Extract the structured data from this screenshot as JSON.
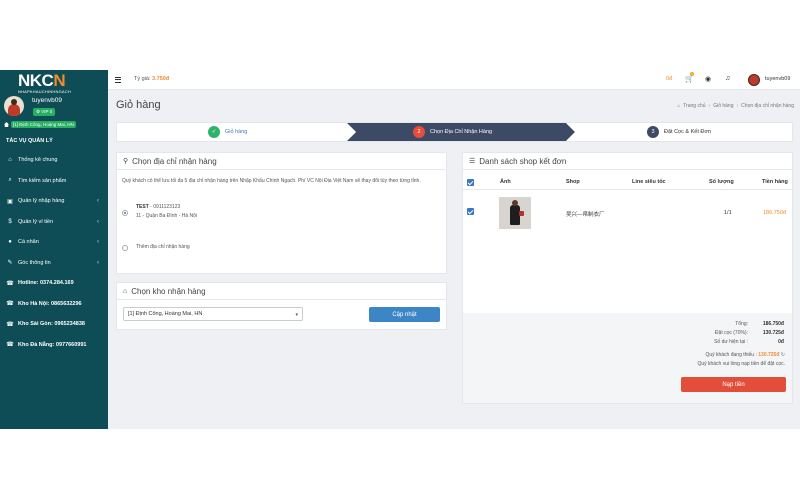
{
  "logo": {
    "text_main": "NKC",
    "text_accent": "N",
    "tagline": "NHAPKHAUCHINHNGACH"
  },
  "user": {
    "name": "tuyenvb09",
    "vip": "VIP 0",
    "address_badge": "[1] Định Công, Hoàng Mai, HN"
  },
  "sidebar": {
    "section_title": "TÁC VỤ QUẢN LÝ",
    "items": [
      {
        "label": "Thống kê chung",
        "icon": "home-icon",
        "glyph": "⌂",
        "chevron": false
      },
      {
        "label": "Tìm kiếm sản phẩm",
        "icon": "search-icon",
        "glyph": "⌕",
        "chevron": false
      },
      {
        "label": "Quản lý nhập hàng",
        "icon": "truck-icon",
        "glyph": "▣",
        "chevron": true
      },
      {
        "label": "Quản lý ví tiền",
        "icon": "dollar-icon",
        "glyph": "$",
        "chevron": true
      },
      {
        "label": "Cá nhân",
        "icon": "user-icon",
        "glyph": "●",
        "chevron": true
      },
      {
        "label": "Góc thông tin",
        "icon": "info-icon",
        "glyph": "✎",
        "chevron": true
      },
      {
        "label": "Hotline: 0374.284.169",
        "icon": "phone-icon",
        "glyph": "☎",
        "chevron": false
      },
      {
        "label": "Kho Hà Nội: 0865632296",
        "icon": "phone-icon",
        "glyph": "☎",
        "chevron": false
      },
      {
        "label": "Kho Sài Gòn: 0965234838",
        "icon": "phone-icon",
        "glyph": "☎",
        "chevron": false
      },
      {
        "label": "Kho Đà Nẵng: 0977660991",
        "icon": "phone-icon",
        "glyph": "☎",
        "chevron": false
      }
    ]
  },
  "topbar": {
    "rate_label": "Tỷ giá:",
    "rate_value": "3.750đ",
    "balance": "0đ",
    "cart_count": "1",
    "username": "tuyenvb09"
  },
  "page": {
    "title": "Giỏ hàng",
    "breadcrumb": [
      "Trang chủ",
      "Giỏ hàng",
      "Chọn địa chỉ nhận hàng"
    ]
  },
  "steps": [
    {
      "num": "✓",
      "label": "Giỏ hàng",
      "state": "done",
      "color": "#2eb36b"
    },
    {
      "num": "2",
      "label": "Chọn Địa Chỉ Nhận Hàng",
      "state": "active",
      "color": "#e74c3c"
    },
    {
      "num": "3",
      "label": "Đặt Cọc & Kết Đơn",
      "state": "todo",
      "color": "#3d4a66"
    }
  ],
  "address_panel": {
    "title": "Chọn địa chỉ nhận hàng",
    "note": "Quý khách có thể lưu tối đa 5 địa chỉ nhận hàng trên Nhập Khẩu Chính Ngạch. Phí VC Nội Địa Việt Nam sẽ thay đổi tùy theo từng tỉnh.",
    "selected_name": "TEST",
    "selected_phone": "- 0911123123",
    "selected_address": "11 - Quận Ba Đình - Hà Nội",
    "add_label": "Thêm địa chỉ nhận hàng"
  },
  "warehouse_panel": {
    "title": "Chọn kho nhận hàng",
    "selected": "[1] Định Công, Hoàng Mai, HN",
    "update_label": "Cập nhật"
  },
  "shop_panel": {
    "title": "Danh sách shop kết đơn",
    "headers": [
      "Ảnh",
      "Shop",
      "Line siêu tốc",
      "Số lượng",
      "Tiền hàng"
    ],
    "rows": [
      {
        "shop": "吴兴—帛制衣厂",
        "line": "",
        "qty": "1/1",
        "amount": "186.750đ"
      }
    ],
    "summary": [
      {
        "label": "Tổng:",
        "value": "186.750đ"
      },
      {
        "label": "Đặt cọc (70%):",
        "value": "130.725đ"
      },
      {
        "label": "Số dư hiện tại :",
        "value": "0đ"
      }
    ],
    "shortfall_label": "Quý khách đang thiếu :",
    "shortfall_value": "130.725đ",
    "topup_note": "Quý khách vui lòng nạp tiền để đặt cọc.",
    "topup_label": "Nạp tiền"
  },
  "colors": {
    "sidebar": "#0f4d56",
    "accent_orange": "#f28a2e",
    "active_step": "#3d4a66",
    "primary_blue": "#3d86c6",
    "danger_red": "#e34e3b"
  }
}
